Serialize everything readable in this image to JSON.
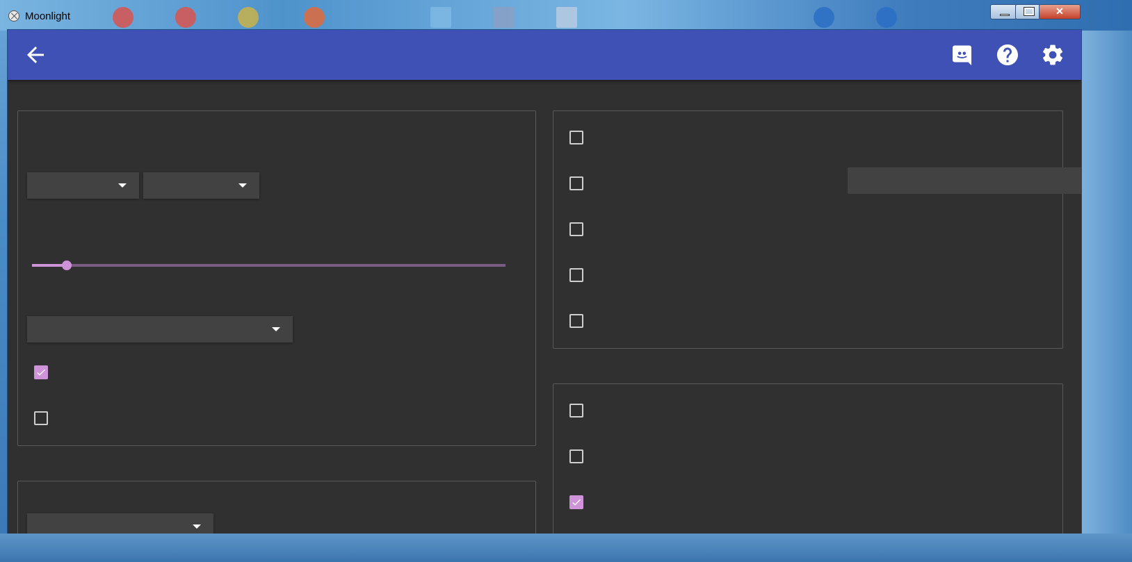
{
  "window": {
    "title": "Moonlight",
    "controls": {
      "minimize": "minimize",
      "maximize": "maximize",
      "close": "close"
    }
  },
  "appbar": {
    "back_icon": "arrow-left-icon",
    "actions": [
      "discord-icon",
      "help-circle-icon",
      "gear-icon"
    ],
    "color": "#3f51b5"
  },
  "colors": {
    "background": "#303030",
    "accent": "#ce93d8",
    "card_border": "#5a5a5a",
    "select_bg": "#424242"
  },
  "left_card": {
    "resolution_select": {
      "value": ""
    },
    "fps_select": {
      "value": ""
    },
    "bitrate_slider": {
      "value_fraction": 0.07
    },
    "display_mode_select": {
      "value": ""
    },
    "checkboxes": [
      {
        "checked": true
      },
      {
        "checked": false
      }
    ]
  },
  "bottom_left_card": {
    "select": {
      "value": ""
    }
  },
  "right_top_card": {
    "checkboxes": [
      {
        "checked": false
      },
      {
        "checked": false
      },
      {
        "checked": false
      },
      {
        "checked": false
      },
      {
        "checked": false
      }
    ]
  },
  "right_bottom_card": {
    "checkboxes": [
      {
        "checked": false
      },
      {
        "checked": false
      },
      {
        "checked": true
      }
    ]
  }
}
